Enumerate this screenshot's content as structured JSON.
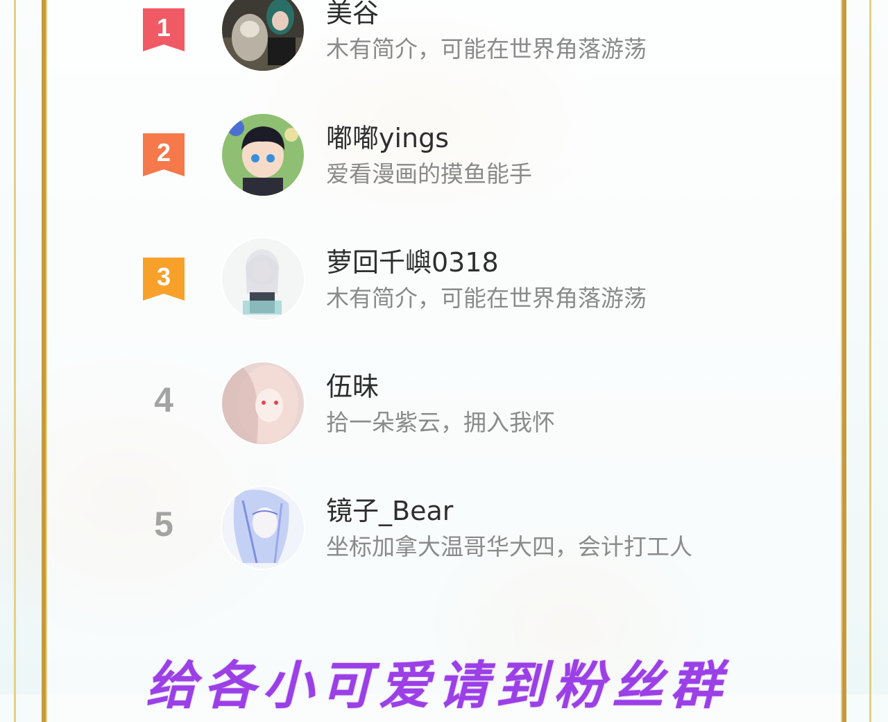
{
  "users": [
    {
      "rank": "1",
      "rank_style": "badge",
      "badge_color": "#f05a64",
      "name": "美谷",
      "bio": "木有简介，可能在世界角落游荡",
      "avatar_icon": "avatar-girl-with-wolf-icon"
    },
    {
      "rank": "2",
      "rank_style": "badge",
      "badge_color": "#f5794a",
      "name": "嘟嘟yings",
      "bio": "爱看漫画的摸鱼能手",
      "avatar_icon": "avatar-anime-boy-icon"
    },
    {
      "rank": "3",
      "rank_style": "badge",
      "badge_color": "#f8a12a",
      "name": "萝回千嶼0318",
      "bio": "木有简介，可能在世界角落游荡",
      "avatar_icon": "avatar-anime-white-hair-icon"
    },
    {
      "rank": "4",
      "rank_style": "plain",
      "name": "伍昧",
      "bio": "拾一朵紫云，拥入我怀",
      "avatar_icon": "avatar-pink-hair-girl-icon"
    },
    {
      "rank": "5",
      "rank_style": "plain",
      "name": "镜子_Bear",
      "bio": "坐标加拿大温哥华大四，会计打工人",
      "avatar_icon": "avatar-blue-sketch-girl-icon"
    }
  ],
  "footer": {
    "text": "给各小可爱请到粉丝群"
  },
  "colors": {
    "gold_frame": "#c49a3a",
    "footer_purple": "#9b3fe6",
    "name_text": "#2e2e2e",
    "bio_text": "#8a8a8a",
    "plain_rank": "#a3a3a3"
  }
}
